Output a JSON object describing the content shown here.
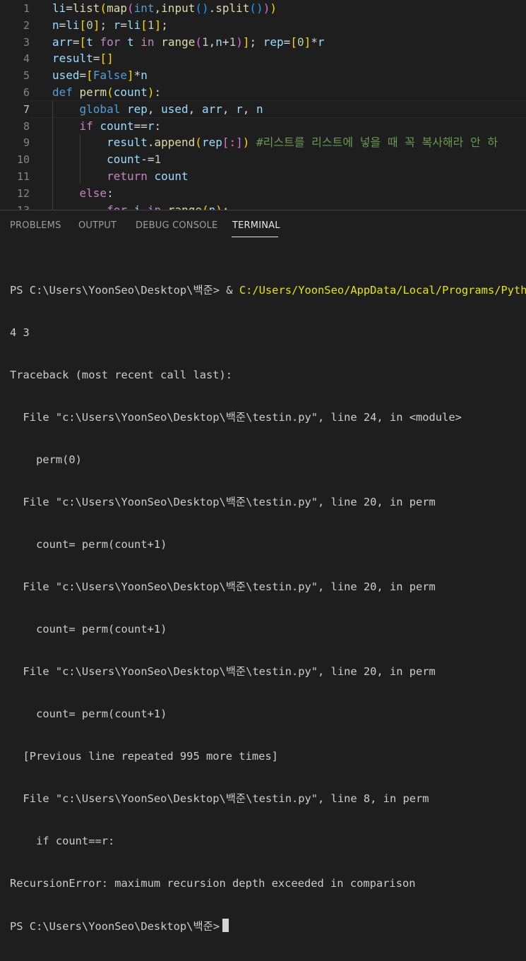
{
  "editor": {
    "lines": [
      {
        "no": "1",
        "segs": [
          [
            "var",
            "li"
          ],
          [
            "txt",
            "="
          ],
          [
            "fn",
            "list"
          ],
          [
            "b1",
            "("
          ],
          [
            "fn",
            "map"
          ],
          [
            "b2",
            "("
          ],
          [
            "kw",
            "int"
          ],
          [
            "txt",
            ","
          ],
          [
            "fn",
            "input"
          ],
          [
            "b3",
            "()"
          ],
          [
            "txt",
            "."
          ],
          [
            "fn",
            "split"
          ],
          [
            "b3",
            "()"
          ],
          [
            "b2",
            ")"
          ],
          [
            "b1",
            ")"
          ]
        ]
      },
      {
        "no": "2",
        "segs": [
          [
            "var",
            "n"
          ],
          [
            "txt",
            "="
          ],
          [
            "var",
            "li"
          ],
          [
            "b1",
            "["
          ],
          [
            "num",
            "0"
          ],
          [
            "b1",
            "]"
          ],
          [
            "txt",
            "; "
          ],
          [
            "var",
            "r"
          ],
          [
            "txt",
            "="
          ],
          [
            "var",
            "li"
          ],
          [
            "b1",
            "["
          ],
          [
            "num",
            "1"
          ],
          [
            "b1",
            "]"
          ],
          [
            "txt",
            ";"
          ]
        ]
      },
      {
        "no": "3",
        "segs": [
          [
            "var",
            "arr"
          ],
          [
            "txt",
            "="
          ],
          [
            "b1",
            "["
          ],
          [
            "var",
            "t"
          ],
          [
            "txt",
            " "
          ],
          [
            "kc",
            "for"
          ],
          [
            "txt",
            " "
          ],
          [
            "var",
            "t"
          ],
          [
            "txt",
            " "
          ],
          [
            "kc",
            "in"
          ],
          [
            "txt",
            " "
          ],
          [
            "fn",
            "range"
          ],
          [
            "b2",
            "("
          ],
          [
            "num",
            "1"
          ],
          [
            "txt",
            ","
          ],
          [
            "var",
            "n"
          ],
          [
            "txt",
            "+"
          ],
          [
            "num",
            "1"
          ],
          [
            "b2",
            ")"
          ],
          [
            "b1",
            "]"
          ],
          [
            "txt",
            "; "
          ],
          [
            "var",
            "rep"
          ],
          [
            "txt",
            "="
          ],
          [
            "b1",
            "["
          ],
          [
            "num",
            "0"
          ],
          [
            "b1",
            "]"
          ],
          [
            "txt",
            "*"
          ],
          [
            "var",
            "r"
          ]
        ]
      },
      {
        "no": "4",
        "segs": [
          [
            "var",
            "result"
          ],
          [
            "txt",
            "="
          ],
          [
            "b1",
            "[]"
          ]
        ]
      },
      {
        "no": "5",
        "segs": [
          [
            "var",
            "used"
          ],
          [
            "txt",
            "="
          ],
          [
            "b1",
            "["
          ],
          [
            "kw",
            "False"
          ],
          [
            "b1",
            "]"
          ],
          [
            "txt",
            "*"
          ],
          [
            "var",
            "n"
          ]
        ]
      },
      {
        "no": "6",
        "segs": [
          [
            "kw",
            "def"
          ],
          [
            "txt",
            " "
          ],
          [
            "fn",
            "perm"
          ],
          [
            "b1",
            "("
          ],
          [
            "var",
            "count"
          ],
          [
            "b1",
            ")"
          ],
          [
            "txt",
            ":"
          ]
        ]
      },
      {
        "no": "7",
        "segs": [
          [
            "txt",
            "    "
          ],
          [
            "kw",
            "global"
          ],
          [
            "txt",
            " "
          ],
          [
            "var",
            "rep"
          ],
          [
            "txt",
            ", "
          ],
          [
            "var",
            "used"
          ],
          [
            "txt",
            ", "
          ],
          [
            "var",
            "arr"
          ],
          [
            "txt",
            ", "
          ],
          [
            "var",
            "r"
          ],
          [
            "txt",
            ", "
          ],
          [
            "var",
            "n"
          ]
        ]
      },
      {
        "no": "8",
        "segs": [
          [
            "txt",
            "    "
          ],
          [
            "kc",
            "if"
          ],
          [
            "txt",
            " "
          ],
          [
            "var",
            "count"
          ],
          [
            "txt",
            "=="
          ],
          [
            "var",
            "r"
          ],
          [
            "txt",
            ":"
          ]
        ]
      },
      {
        "no": "9",
        "segs": [
          [
            "txt",
            "        "
          ],
          [
            "var",
            "result"
          ],
          [
            "txt",
            "."
          ],
          [
            "fn",
            "append"
          ],
          [
            "b1",
            "("
          ],
          [
            "var",
            "rep"
          ],
          [
            "b2",
            "[:]"
          ],
          [
            "b1",
            ")"
          ],
          [
            "txt",
            " "
          ],
          [
            "cmt",
            "#리스트를 리스트에 넣을 때 꼭 복사해라 안 하"
          ]
        ]
      },
      {
        "no": "10",
        "segs": [
          [
            "txt",
            "        "
          ],
          [
            "var",
            "count"
          ],
          [
            "txt",
            "-="
          ],
          [
            "num",
            "1"
          ]
        ]
      },
      {
        "no": "11",
        "segs": [
          [
            "txt",
            "        "
          ],
          [
            "kc",
            "return"
          ],
          [
            "txt",
            " "
          ],
          [
            "var",
            "count"
          ]
        ]
      },
      {
        "no": "12",
        "segs": [
          [
            "txt",
            "    "
          ],
          [
            "kc",
            "else"
          ],
          [
            "txt",
            ":"
          ]
        ]
      },
      {
        "no": "13",
        "segs": [
          [
            "txt",
            "        "
          ],
          [
            "kc",
            "for"
          ],
          [
            "txt",
            " "
          ],
          [
            "var",
            "i"
          ],
          [
            "txt",
            " "
          ],
          [
            "kc",
            "in"
          ],
          [
            "txt",
            " "
          ],
          [
            "fn",
            "range"
          ],
          [
            "b1",
            "("
          ],
          [
            "var",
            "n"
          ],
          [
            "b1",
            ")"
          ],
          [
            "txt",
            ":"
          ]
        ]
      }
    ]
  },
  "panel": {
    "tabs": [
      {
        "label": "PROBLEMS",
        "active": false
      },
      {
        "label": "OUTPUT",
        "active": false
      },
      {
        "label": "DEBUG CONSOLE",
        "active": false
      },
      {
        "label": "TERMINAL",
        "active": true
      }
    ]
  },
  "terminal": {
    "prompt_cmd": "PS C:\\Users\\YoonSeo\\Desktop\\백준> & ",
    "cmd_path": "C:/Users/YoonSeo/AppData/Local/Programs/Python",
    "lines": [
      "4 3",
      "Traceback (most recent call last):",
      "  File \"c:\\Users\\YoonSeo\\Desktop\\백준\\testin.py\", line 24, in <module>",
      "    perm(0)",
      "  File \"c:\\Users\\YoonSeo\\Desktop\\백준\\testin.py\", line 20, in perm",
      "    count= perm(count+1)",
      "  File \"c:\\Users\\YoonSeo\\Desktop\\백준\\testin.py\", line 20, in perm",
      "    count= perm(count+1)",
      "  File \"c:\\Users\\YoonSeo\\Desktop\\백준\\testin.py\", line 20, in perm",
      "    count= perm(count+1)",
      "  [Previous line repeated 995 more times]",
      "  File \"c:\\Users\\YoonSeo\\Desktop\\백준\\testin.py\", line 8, in perm",
      "    if count==r:",
      "RecursionError: maximum recursion depth exceeded in comparison"
    ],
    "final_prompt": "PS C:\\Users\\YoonSeo\\Desktop\\백준>"
  }
}
